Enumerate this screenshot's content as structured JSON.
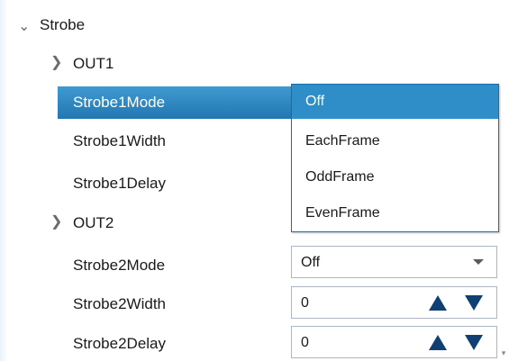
{
  "tree": {
    "group": {
      "label": "Strobe"
    },
    "out1": {
      "label": "OUT1"
    },
    "out2": {
      "label": "OUT2"
    }
  },
  "properties": {
    "strobe1_mode": {
      "label": "Strobe1Mode"
    },
    "strobe1_width": {
      "label": "Strobe1Width"
    },
    "strobe1_delay": {
      "label": "Strobe1Delay"
    },
    "strobe2_mode": {
      "label": "Strobe2Mode",
      "value": "Off"
    },
    "strobe2_width": {
      "label": "Strobe2Width",
      "value": "0"
    },
    "strobe2_delay": {
      "label": "Strobe2Delay",
      "value": "0"
    }
  },
  "dropdown": {
    "options": [
      "Off",
      "EachFrame",
      "OddFrame",
      "EvenFrame"
    ],
    "selected": "Off"
  },
  "icons": {
    "expanded": "chevron-down-icon",
    "collapsed": "chevron-right-icon",
    "select_caret": "caret-down-icon",
    "spin_up": "spin-up-icon",
    "spin_down": "spin-down-icon"
  },
  "colors": {
    "selection": "#2f8dc8",
    "dropdown_border": "#1a6fa8",
    "spinner": "#0f3f73"
  }
}
